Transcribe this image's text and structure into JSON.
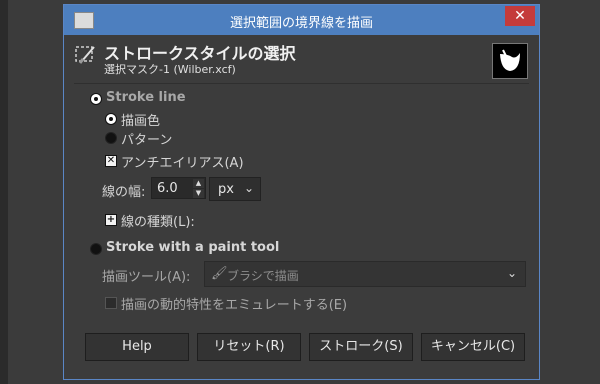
{
  "window": {
    "title": "選択範囲の境界線を描画",
    "close_glyph": "✕"
  },
  "header": {
    "title": "ストロークスタイルの選択",
    "subtitle": "選択マスク-1 (Wilber.xcf)"
  },
  "stroke_line": {
    "label": "Stroke line",
    "selected": true,
    "fill_options": [
      {
        "label": "描画色",
        "selected": true
      },
      {
        "label": "パターン",
        "selected": false
      }
    ],
    "antialias": {
      "label": "アンチエイリアス(A)",
      "checked": true
    },
    "line_width": {
      "label": "線の幅:",
      "value": "6.0",
      "unit": "px"
    },
    "line_style": {
      "expander_label": "線の種類(L):"
    }
  },
  "paint_tool": {
    "label": "Stroke with a paint tool",
    "selected": false,
    "tool_label": "描画ツール(A):",
    "tool_value": "ブラシで描画",
    "emulate": {
      "label": "描画の動的特性をエミュレートする(E)",
      "checked": false
    }
  },
  "buttons": {
    "help": "Help",
    "reset": "リセット(R)",
    "stroke": "ストローク(S)",
    "cancel": "キャンセル(C)"
  },
  "icons": {
    "app": "gimp-icon",
    "header": "stroke-selection-icon",
    "preview": "wilber-preview"
  },
  "colors": {
    "titlebar": "#4d7fbf",
    "close": "#c43b3b",
    "background": "#3c3c3c"
  }
}
